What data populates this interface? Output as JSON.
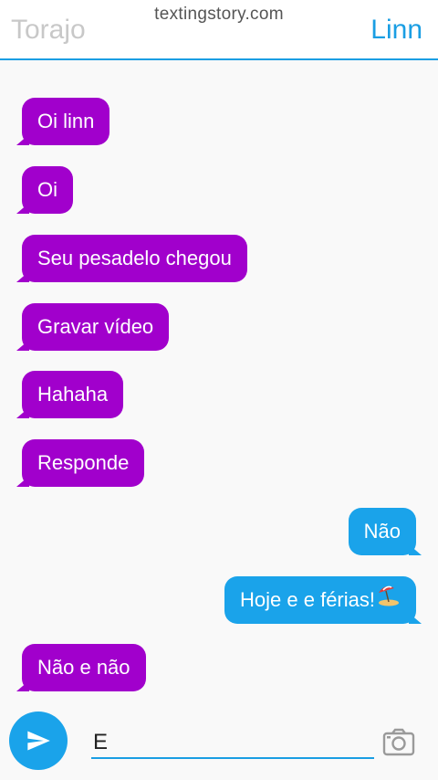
{
  "header": {
    "contact_left": "Torajo",
    "watermark": "textingstory.com",
    "contact_right": "Linn"
  },
  "messages": [
    {
      "side": "left",
      "text": "Oi linn"
    },
    {
      "side": "left",
      "text": "Oi"
    },
    {
      "side": "left",
      "text": "Seu pesadelo chegou"
    },
    {
      "side": "left",
      "text": "Gravar vídeo"
    },
    {
      "side": "left",
      "text": "Hahaha"
    },
    {
      "side": "left",
      "text": "Responde"
    },
    {
      "side": "right",
      "text": "Não"
    },
    {
      "side": "right",
      "text": "Hoje e e férias!",
      "emoji": "beach-umbrella-icon"
    },
    {
      "side": "left",
      "text": "Não e não"
    }
  ],
  "composer": {
    "input_value": "E",
    "send_icon": "send-icon",
    "camera_icon": "camera-icon"
  },
  "colors": {
    "accent": "#1a9ee3",
    "left_bubble": "#a100cc",
    "right_bubble": "#1aa3ea"
  }
}
